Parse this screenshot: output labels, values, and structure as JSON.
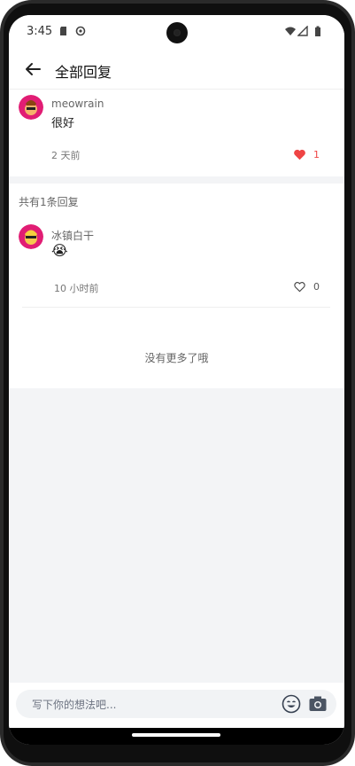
{
  "status_bar": {
    "time": "3:45",
    "icons": [
      "sd-card-icon",
      "sync-icon",
      "wifi-icon",
      "signal-icon",
      "battery-icon"
    ]
  },
  "app_bar": {
    "title": "全部回复",
    "back_icon": "back-arrow-icon"
  },
  "parent_comment": {
    "username": "meowrain",
    "text": "很好",
    "time_ago": "2 天前",
    "likes": "1",
    "liked": true
  },
  "replies_section": {
    "count_label": "共有1条回复",
    "replies": [
      {
        "username": "冰镇白干",
        "emoji": "😭",
        "time_ago": "10 小时前",
        "likes": "0",
        "liked": false
      }
    ],
    "end_text": "没有更多了哦"
  },
  "composer": {
    "placeholder": "写下你的想法吧...",
    "emoji_icon": "smile-icon",
    "camera_icon": "camera-icon"
  },
  "colors": {
    "like_active": "#ef4444",
    "muted_text": "#666666",
    "page_bg": "#f3f4f6"
  }
}
